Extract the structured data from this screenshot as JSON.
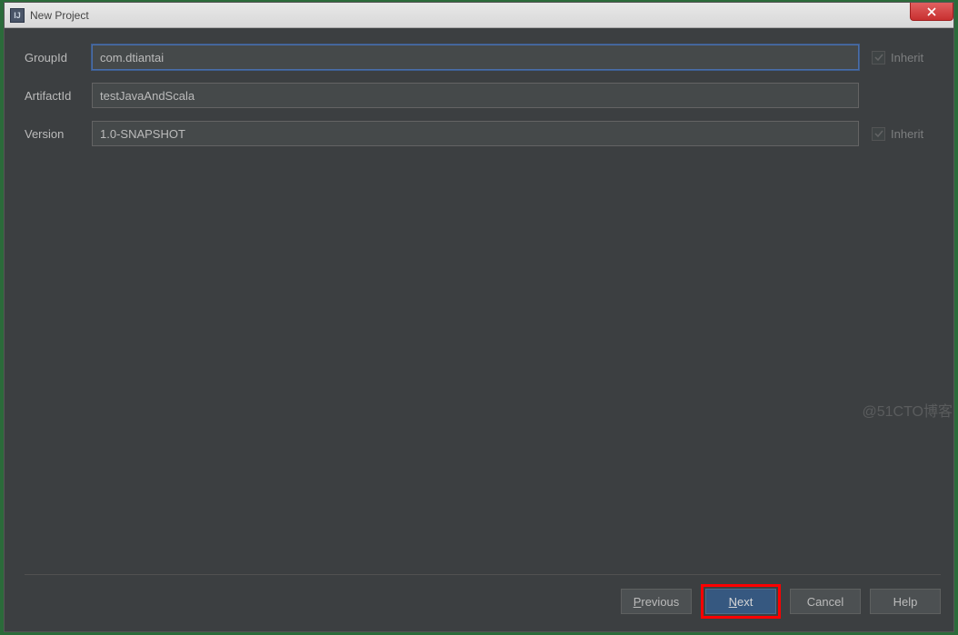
{
  "window": {
    "title": "New Project"
  },
  "form": {
    "groupId": {
      "label": "GroupId",
      "value": "com.dtiantai",
      "inherit_label": "Inherit"
    },
    "artifactId": {
      "label": "ArtifactId",
      "value": "testJavaAndScala"
    },
    "version": {
      "label": "Version",
      "value": "1.0-SNAPSHOT",
      "inherit_label": "Inherit"
    }
  },
  "buttons": {
    "previous": "Previous",
    "next": "Next",
    "cancel": "Cancel",
    "help": "Help"
  },
  "watermark": "@51CTO博客"
}
